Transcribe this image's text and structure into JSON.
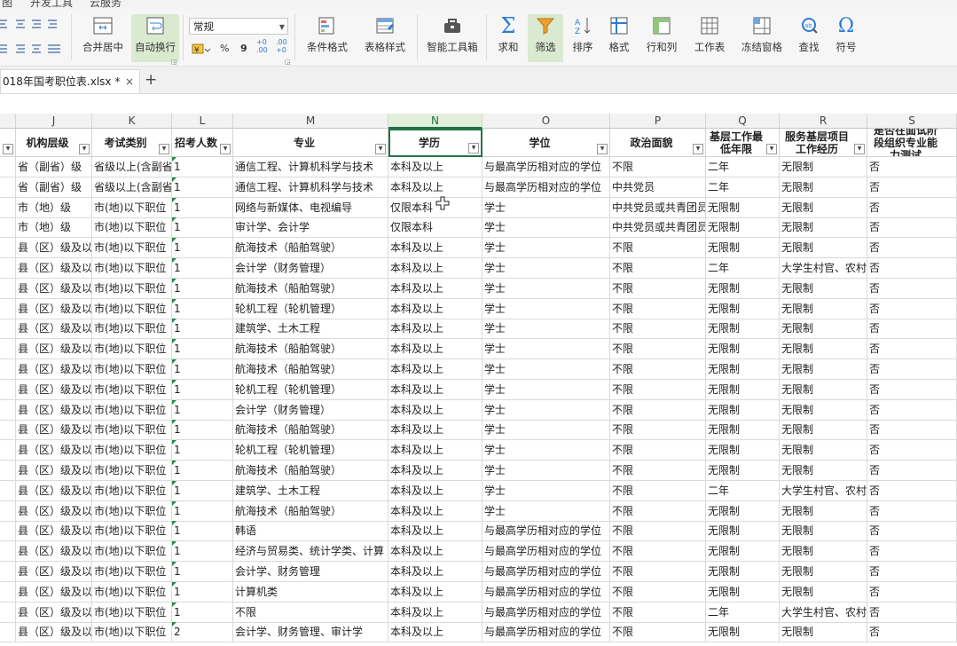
{
  "menubar": {
    "items": [
      "图",
      "开发工具",
      "云服务"
    ]
  },
  "ribbon": {
    "font_combo": "常规",
    "merge_center": "合并居中",
    "auto_wrap": "自动换行",
    "percent": "%",
    "comma": "9",
    "dec_inc": "+0\n.00",
    "dec_dec": ".00\n+0",
    "cond_format": "条件格式",
    "table_style": "表格样式",
    "smart_toolbox": "智能工具箱",
    "sum": "求和",
    "filter": "筛选",
    "sort": "排序",
    "format": "格式",
    "row_col": "行和列",
    "worksheet": "工作表",
    "freeze": "冻结窗格",
    "find": "查找",
    "symbol": "符号"
  },
  "tabs": {
    "doc_title": "018年国考职位表.xlsx *",
    "close": "×",
    "new": "+"
  },
  "columns": [
    "J",
    "K",
    "L",
    "M",
    "N",
    "O",
    "P",
    "Q",
    "R",
    "S"
  ],
  "headers": [
    "机构层级",
    "考试类别",
    "招考人数",
    "专业",
    "学历",
    "学位",
    "政治面貌",
    "基层工作最低年限",
    "服务基层项目工作经历",
    "是否在面试阶段组织专业能力测试"
  ],
  "rows": [
    [
      "省（副省）级",
      "省级以上(含副省",
      "1",
      "通信工程、计算机科学与技术",
      "本科及以上",
      "与最高学历相对应的学位",
      "不限",
      "二年",
      "无限制",
      "否"
    ],
    [
      "省（副省）级",
      "省级以上(含副省",
      "1",
      "通信工程、计算机科学与技术",
      "本科及以上",
      "与最高学历相对应的学位",
      "中共党员",
      "二年",
      "无限制",
      "否"
    ],
    [
      "市（地）级",
      "市(地)以下职位",
      "1",
      "网络与新媒体、电视编导",
      "仅限本科",
      "学士",
      "中共党员或共青团员",
      "无限制",
      "无限制",
      "否"
    ],
    [
      "市（地）级",
      "市(地)以下职位",
      "1",
      "审计学、会计学",
      "仅限本科",
      "学士",
      "中共党员或共青团员",
      "无限制",
      "无限制",
      "否"
    ],
    [
      "县（区）级及以",
      "市(地)以下职位",
      "1",
      "航海技术（船舶驾驶）",
      "本科及以上",
      "学士",
      "不限",
      "无限制",
      "无限制",
      "否"
    ],
    [
      "县（区）级及以",
      "市(地)以下职位",
      "1",
      "会计学（财务管理）",
      "本科及以上",
      "学士",
      "不限",
      "二年",
      "大学生村官、农村",
      "否"
    ],
    [
      "县（区）级及以",
      "市(地)以下职位",
      "1",
      "航海技术（船舶驾驶）",
      "本科及以上",
      "学士",
      "不限",
      "无限制",
      "无限制",
      "否"
    ],
    [
      "县（区）级及以",
      "市(地)以下职位",
      "1",
      "轮机工程（轮机管理）",
      "本科及以上",
      "学士",
      "不限",
      "无限制",
      "无限制",
      "否"
    ],
    [
      "县（区）级及以",
      "市(地)以下职位",
      "1",
      "建筑学、土木工程",
      "本科及以上",
      "学士",
      "不限",
      "无限制",
      "无限制",
      "否"
    ],
    [
      "县（区）级及以",
      "市(地)以下职位",
      "1",
      "航海技术（船舶驾驶）",
      "本科及以上",
      "学士",
      "不限",
      "无限制",
      "无限制",
      "否"
    ],
    [
      "县（区）级及以",
      "市(地)以下职位",
      "1",
      "航海技术（船舶驾驶）",
      "本科及以上",
      "学士",
      "不限",
      "无限制",
      "无限制",
      "否"
    ],
    [
      "县（区）级及以",
      "市(地)以下职位",
      "1",
      "轮机工程（轮机管理）",
      "本科及以上",
      "学士",
      "不限",
      "无限制",
      "无限制",
      "否"
    ],
    [
      "县（区）级及以",
      "市(地)以下职位",
      "1",
      "会计学（财务管理）",
      "本科及以上",
      "学士",
      "不限",
      "无限制",
      "无限制",
      "否"
    ],
    [
      "县（区）级及以",
      "市(地)以下职位",
      "1",
      "航海技术（船舶驾驶）",
      "本科及以上",
      "学士",
      "不限",
      "无限制",
      "无限制",
      "否"
    ],
    [
      "县（区）级及以",
      "市(地)以下职位",
      "1",
      "轮机工程（轮机管理）",
      "本科及以上",
      "学士",
      "不限",
      "无限制",
      "无限制",
      "否"
    ],
    [
      "县（区）级及以",
      "市(地)以下职位",
      "1",
      "航海技术（船舶驾驶）",
      "本科及以上",
      "学士",
      "不限",
      "无限制",
      "无限制",
      "否"
    ],
    [
      "县（区）级及以",
      "市(地)以下职位",
      "1",
      "建筑学、土木工程",
      "本科及以上",
      "学士",
      "不限",
      "二年",
      "大学生村官、农村",
      "否"
    ],
    [
      "县（区）级及以",
      "市(地)以下职位",
      "1",
      "航海技术（船舶驾驶）",
      "本科及以上",
      "学士",
      "不限",
      "无限制",
      "无限制",
      "否"
    ],
    [
      "县（区）级及以",
      "市(地)以下职位",
      "1",
      "韩语",
      "本科及以上",
      "与最高学历相对应的学位",
      "不限",
      "无限制",
      "无限制",
      "否"
    ],
    [
      "县（区）级及以",
      "市(地)以下职位",
      "1",
      "经济与贸易类、统计学类、计算",
      "本科及以上",
      "与最高学历相对应的学位",
      "不限",
      "无限制",
      "无限制",
      "否"
    ],
    [
      "县（区）级及以",
      "市(地)以下职位",
      "1",
      "会计学、财务管理",
      "本科及以上",
      "与最高学历相对应的学位",
      "不限",
      "无限制",
      "无限制",
      "否"
    ],
    [
      "县（区）级及以",
      "市(地)以下职位",
      "1",
      "计算机类",
      "本科及以上",
      "与最高学历相对应的学位",
      "不限",
      "无限制",
      "无限制",
      "否"
    ],
    [
      "县（区）级及以",
      "市(地)以下职位",
      "1",
      "不限",
      "本科及以上",
      "与最高学历相对应的学位",
      "不限",
      "二年",
      "大学生村官、农村",
      "否"
    ],
    [
      "县（区）级及以",
      "市(地)以下职位",
      "2",
      "会计学、财务管理、审计学",
      "本科及以上",
      "与最高学历相对应的学位",
      "不限",
      "无限制",
      "无限制",
      "否"
    ]
  ],
  "colors": {
    "accent_green": "#217346",
    "selected_header_bg": "#e2efda",
    "filter_active_bg": "#d9ead0"
  }
}
